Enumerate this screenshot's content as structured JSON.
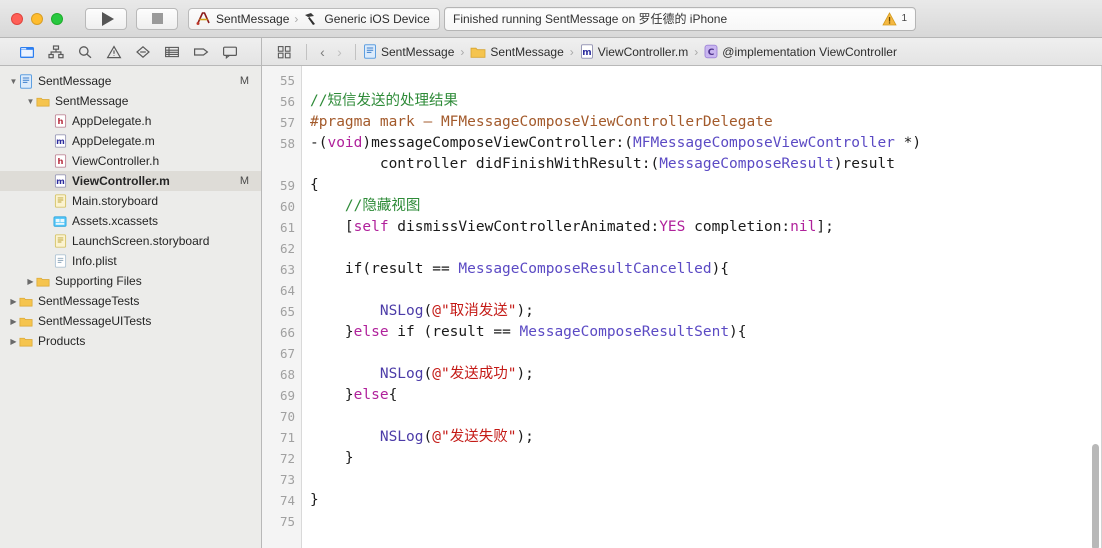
{
  "window": {
    "traffic_lights": [
      "close",
      "minimize",
      "zoom"
    ]
  },
  "toolbar": {
    "run_label": "Run",
    "stop_label": "Stop",
    "scheme": "SentMessage",
    "destination": "Generic iOS Device",
    "scheme_separator": "›"
  },
  "status": {
    "message": "Finished running SentMessage on 罗任德的 iPhone",
    "warning_count": "1",
    "warning_color": "#F5B841"
  },
  "navigator_toolbar": {
    "icons": [
      "folder-icon",
      "hierarchy-icon",
      "search-icon",
      "warning-triangle-icon",
      "diamond-icon",
      "list-icon",
      "tag-icon",
      "comment-icon"
    ],
    "selected_index": 0
  },
  "jumpbar": {
    "related_items_label": "Related Items",
    "back_label": "‹",
    "forward_label": "›",
    "separator": "›",
    "breadcrumbs": [
      {
        "label": "SentMessage",
        "icon": "project-icon"
      },
      {
        "label": "SentMessage",
        "icon": "folder-icon"
      },
      {
        "label": "ViewController.m",
        "icon": "m-file-icon"
      },
      {
        "label": "@implementation ViewController",
        "icon": "class-icon"
      }
    ]
  },
  "navigator": {
    "items": [
      {
        "label": "SentMessage",
        "icon": "project-icon",
        "indent": 0,
        "disclosure": "open",
        "badge": "M",
        "selected": false
      },
      {
        "label": "SentMessage",
        "icon": "folder-icon",
        "indent": 1,
        "disclosure": "open",
        "badge": "",
        "selected": false
      },
      {
        "label": "AppDelegate.h",
        "icon": "h-file-icon",
        "indent": 2,
        "disclosure": "none",
        "badge": "",
        "selected": false
      },
      {
        "label": "AppDelegate.m",
        "icon": "m-file-icon",
        "indent": 2,
        "disclosure": "none",
        "badge": "",
        "selected": false
      },
      {
        "label": "ViewController.h",
        "icon": "h-file-icon",
        "indent": 2,
        "disclosure": "none",
        "badge": "",
        "selected": false
      },
      {
        "label": "ViewController.m",
        "icon": "m-file-icon",
        "indent": 2,
        "disclosure": "none",
        "badge": "M",
        "selected": true
      },
      {
        "label": "Main.storyboard",
        "icon": "storyboard-icon",
        "indent": 2,
        "disclosure": "none",
        "badge": "",
        "selected": false
      },
      {
        "label": "Assets.xcassets",
        "icon": "assets-icon",
        "indent": 2,
        "disclosure": "none",
        "badge": "",
        "selected": false
      },
      {
        "label": "LaunchScreen.storyboard",
        "icon": "storyboard-icon",
        "indent": 2,
        "disclosure": "none",
        "badge": "",
        "selected": false
      },
      {
        "label": "Info.plist",
        "icon": "plist-icon",
        "indent": 2,
        "disclosure": "none",
        "badge": "",
        "selected": false
      },
      {
        "label": "Supporting Files",
        "icon": "folder-icon",
        "indent": 1,
        "disclosure": "closed",
        "badge": "",
        "selected": false
      },
      {
        "label": "SentMessageTests",
        "icon": "folder-icon",
        "indent": 0,
        "disclosure": "closed",
        "badge": "",
        "selected": false
      },
      {
        "label": "SentMessageUITests",
        "icon": "folder-icon",
        "indent": 0,
        "disclosure": "closed",
        "badge": "",
        "selected": false
      },
      {
        "label": "Products",
        "icon": "folder-icon",
        "indent": 0,
        "disclosure": "closed",
        "badge": "",
        "selected": false
      }
    ]
  },
  "editor": {
    "first_line": 55,
    "gutter_lines": [
      "55",
      "56",
      "57",
      "58",
      "",
      "59",
      "60",
      "61",
      "62",
      "63",
      "64",
      "65",
      "66",
      "67",
      "68",
      "69",
      "70",
      "71",
      "72",
      "73",
      "74",
      "75"
    ],
    "syntax_colors": {
      "comment": "#2E8B38",
      "preprocessor": "#A35A2B",
      "keyword": "#B0219B",
      "type": "#5B4AC4",
      "function": "#4C3CA8",
      "string": "#C41A16",
      "plain": "#1A1A1A"
    },
    "lines": [
      {
        "n": "55",
        "tokens": []
      },
      {
        "n": "56",
        "tokens": [
          {
            "t": "//短信发送的处理结果",
            "c": "cmt"
          }
        ]
      },
      {
        "n": "57",
        "tokens": [
          {
            "t": "#pragma mark — MFMessageComposeViewControllerDelegate",
            "c": "pre"
          }
        ]
      },
      {
        "n": "58",
        "tokens": [
          {
            "t": "-(",
            "c": ""
          },
          {
            "t": "void",
            "c": "kw"
          },
          {
            "t": ")messageComposeViewController:(",
            "c": ""
          },
          {
            "t": "MFMessageComposeViewController",
            "c": "typ"
          },
          {
            "t": " *)",
            "c": ""
          }
        ]
      },
      {
        "n": "",
        "tokens": [
          {
            "t": "        controller didFinishWithResult:(",
            "c": ""
          },
          {
            "t": "MessageComposeResult",
            "c": "typ"
          },
          {
            "t": ")result",
            "c": ""
          }
        ]
      },
      {
        "n": "59",
        "tokens": [
          {
            "t": "{",
            "c": ""
          }
        ]
      },
      {
        "n": "60",
        "tokens": [
          {
            "t": "    ",
            "c": ""
          },
          {
            "t": "//隐藏视图",
            "c": "cmt"
          }
        ]
      },
      {
        "n": "61",
        "tokens": [
          {
            "t": "    [",
            "c": ""
          },
          {
            "t": "self",
            "c": "kw"
          },
          {
            "t": " dismissViewControllerAnimated:",
            "c": ""
          },
          {
            "t": "YES",
            "c": "kw"
          },
          {
            "t": " completion:",
            "c": ""
          },
          {
            "t": "nil",
            "c": "kw"
          },
          {
            "t": "];",
            "c": ""
          }
        ]
      },
      {
        "n": "62",
        "tokens": []
      },
      {
        "n": "63",
        "tokens": [
          {
            "t": "    if(result == ",
            "c": ""
          },
          {
            "t": "MessageComposeResultCancelled",
            "c": "typ"
          },
          {
            "t": "){",
            "c": ""
          }
        ]
      },
      {
        "n": "64",
        "tokens": []
      },
      {
        "n": "65",
        "tokens": [
          {
            "t": "        ",
            "c": ""
          },
          {
            "t": "NSLog",
            "c": "fn"
          },
          {
            "t": "(",
            "c": ""
          },
          {
            "t": "@\"取消发送\"",
            "c": "str"
          },
          {
            "t": ");",
            "c": ""
          }
        ]
      },
      {
        "n": "66",
        "tokens": [
          {
            "t": "    }",
            "c": ""
          },
          {
            "t": "else",
            "c": "kw"
          },
          {
            "t": " if (result == ",
            "c": ""
          },
          {
            "t": "MessageComposeResultSent",
            "c": "typ"
          },
          {
            "t": "){",
            "c": ""
          }
        ]
      },
      {
        "n": "67",
        "tokens": []
      },
      {
        "n": "68",
        "tokens": [
          {
            "t": "        ",
            "c": ""
          },
          {
            "t": "NSLog",
            "c": "fn"
          },
          {
            "t": "(",
            "c": ""
          },
          {
            "t": "@\"发送成功\"",
            "c": "str"
          },
          {
            "t": ");",
            "c": ""
          }
        ]
      },
      {
        "n": "69",
        "tokens": [
          {
            "t": "    }",
            "c": ""
          },
          {
            "t": "else",
            "c": "kw"
          },
          {
            "t": "{",
            "c": ""
          }
        ]
      },
      {
        "n": "70",
        "tokens": []
      },
      {
        "n": "71",
        "tokens": [
          {
            "t": "        ",
            "c": ""
          },
          {
            "t": "NSLog",
            "c": "fn"
          },
          {
            "t": "(",
            "c": ""
          },
          {
            "t": "@\"发送失败\"",
            "c": "str"
          },
          {
            "t": ");",
            "c": ""
          }
        ]
      },
      {
        "n": "72",
        "tokens": [
          {
            "t": "    }",
            "c": ""
          }
        ]
      },
      {
        "n": "73",
        "tokens": []
      },
      {
        "n": "74",
        "tokens": [
          {
            "t": "}",
            "c": ""
          }
        ]
      },
      {
        "n": "75",
        "tokens": []
      }
    ]
  }
}
